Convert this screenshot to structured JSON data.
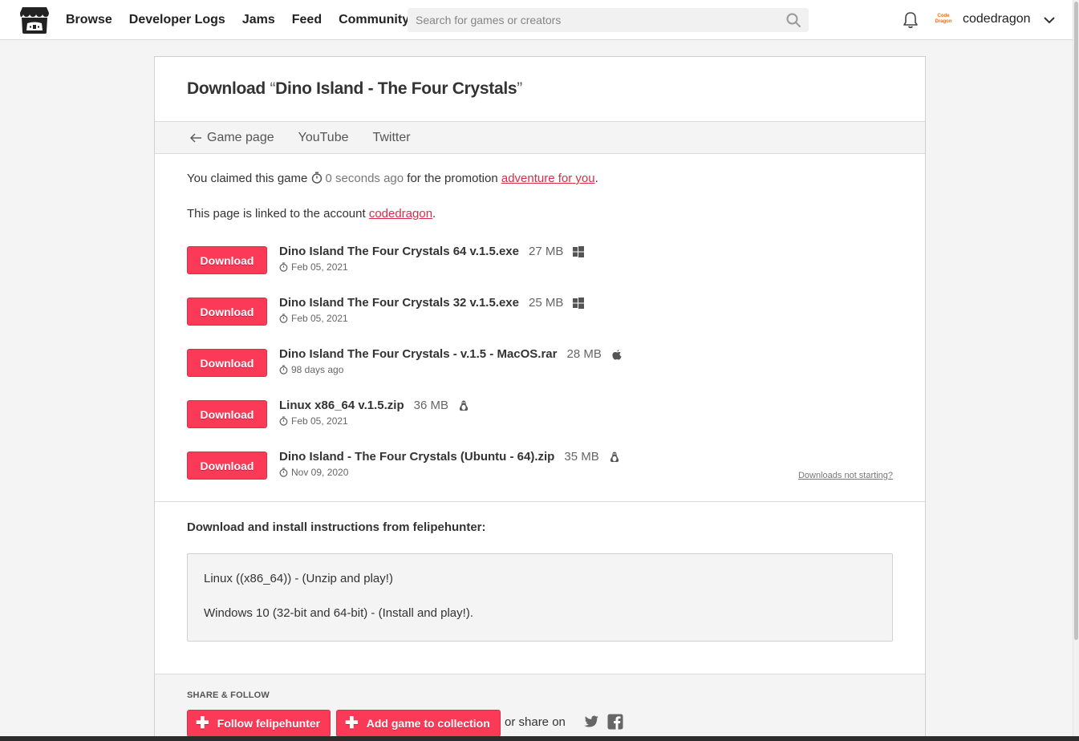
{
  "nav": {
    "items": [
      "Browse",
      "Developer Logs",
      "Jams",
      "Feed",
      "Community"
    ],
    "search_placeholder": "Search for games or creators",
    "avatar_text_1": "Code",
    "avatar_text_2": "Dragon",
    "username": "codedragon"
  },
  "page": {
    "title_prefix": "Download ",
    "title_open_quote": "“",
    "title_game": "Dino Island - The Four Crystals",
    "title_close_quote": "”",
    "subnav": [
      "Game page",
      "YouTube",
      "Twitter"
    ],
    "claim": {
      "before": "You claimed this game ",
      "time": "0 seconds ago",
      "middle": " for the promotion ",
      "link": "adventure for you",
      "after": "."
    },
    "linked": {
      "before": "This page is linked to the account ",
      "link": "codedragon",
      "after": "."
    },
    "download_label": "Download",
    "files": [
      {
        "name": "Dino Island The Four Crystals 64 v.1.5.exe",
        "size": "27 MB",
        "os": "windows-icon",
        "date": "Feb 05, 2021"
      },
      {
        "name": "Dino Island The Four Crystals 32 v.1.5.exe",
        "size": "25 MB",
        "os": "windows-icon",
        "date": "Feb 05, 2021"
      },
      {
        "name": "Dino Island The Four Crystals - v.1.5 - MacOS.rar",
        "size": "28 MB",
        "os": "apple-icon",
        "date": "98 days ago"
      },
      {
        "name": "Linux x86_64 v.1.5.zip",
        "size": "36 MB",
        "os": "linux-icon",
        "date": "Feb 05, 2021"
      },
      {
        "name": "Dino Island - The Four Crystals (Ubuntu - 64).zip",
        "size": "35 MB",
        "os": "linux-icon",
        "date": "Nov 09, 2020"
      }
    ],
    "not_starting": "Downloads not starting?",
    "instructions_heading": "Download and install instructions from felipehunter:",
    "instructions": [
      "Linux ((x86_64)) - (Unzip and play!)",
      "Windows 10 (32-bit and 64-bit) - (Install and play!)."
    ],
    "share_label": "SHARE & FOLLOW",
    "follow_label": "Follow felipehunter",
    "collection_label": "Add game to collection",
    "share_on": "or share on"
  },
  "colors": {
    "accent": "#fa3a57",
    "link": "#da2c49"
  }
}
